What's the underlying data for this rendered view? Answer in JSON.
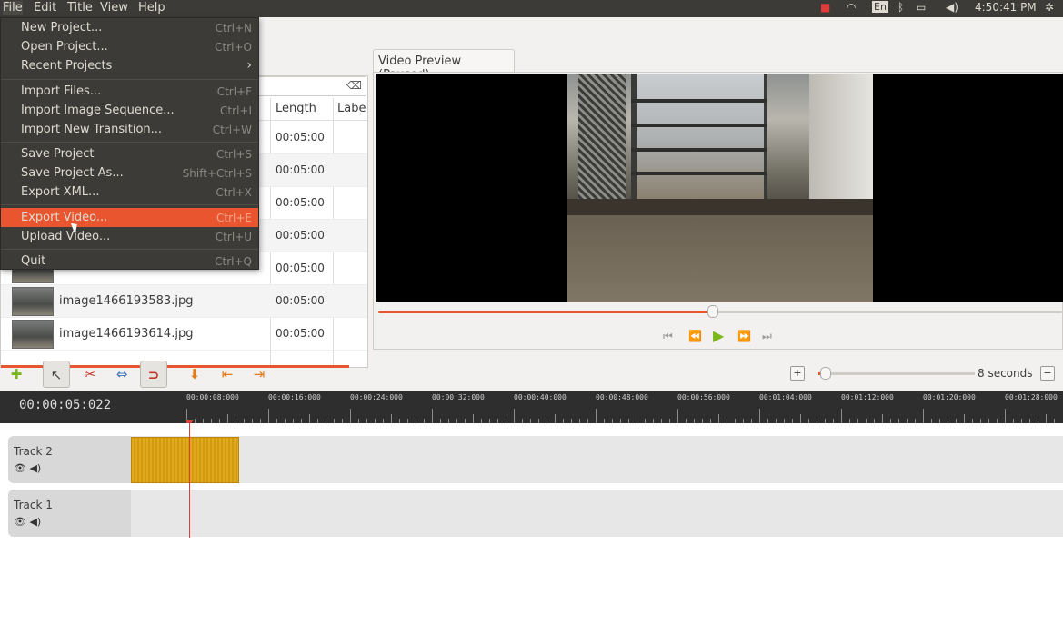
{
  "menubar": {
    "items": [
      {
        "label": "File"
      },
      {
        "label": "Edit"
      },
      {
        "label": "Title"
      },
      {
        "label": "View"
      },
      {
        "label": "Help"
      }
    ]
  },
  "tray": {
    "keyboard": "En",
    "clock": "4:50:41 PM"
  },
  "file_menu": {
    "items": [
      {
        "label": "New Project...",
        "shortcut": "Ctrl+N"
      },
      {
        "label": "Open Project...",
        "shortcut": "Ctrl+O"
      },
      {
        "label": "Recent Projects",
        "shortcut": "›"
      },
      {
        "label": "Import Files...",
        "shortcut": "Ctrl+F"
      },
      {
        "label": "Import Image Sequence...",
        "shortcut": "Ctrl+I"
      },
      {
        "label": "Import New Transition...",
        "shortcut": "Ctrl+W"
      },
      {
        "label": "Save Project",
        "shortcut": "Ctrl+S"
      },
      {
        "label": "Save Project As...",
        "shortcut": "Shift+Ctrl+S"
      },
      {
        "label": "Export XML...",
        "shortcut": "Ctrl+X"
      },
      {
        "label": "Export Video...",
        "shortcut": "Ctrl+E"
      },
      {
        "label": "Upload Video...",
        "shortcut": "Ctrl+U"
      },
      {
        "label": "Quit",
        "shortcut": "Ctrl+Q"
      }
    ]
  },
  "files": {
    "columns": {
      "length": "Length",
      "label": "Labe"
    },
    "rows": [
      {
        "name": "",
        "length": "00:05:00"
      },
      {
        "name": "",
        "length": "00:05:00"
      },
      {
        "name": "",
        "length": "00:05:00"
      },
      {
        "name": "",
        "length": "00:05:00"
      },
      {
        "name": "",
        "length": "00:05:00"
      },
      {
        "name": "image1466193583.jpg",
        "length": "00:05:00"
      },
      {
        "name": "image1466193614.jpg",
        "length": "00:05:00"
      }
    ]
  },
  "preview": {
    "tab_label": "Video Preview (Paused)",
    "progress": 0.49
  },
  "toolbar": {
    "zoom_label": "8 seconds"
  },
  "timeline": {
    "timecode": "00:00:05:022",
    "ticks": [
      "00:00:08:000",
      "00:00:16:000",
      "00:00:24:000",
      "00:00:32:000",
      "00:00:40:000",
      "00:00:48:000",
      "00:00:56:000",
      "00:01:04:000",
      "00:01:12:000",
      "00:01:20:000",
      "00:01:28:000"
    ],
    "tracks": [
      {
        "name": "Track 2"
      },
      {
        "name": "Track 1"
      }
    ]
  },
  "colors": {
    "accent": "#e8552e",
    "clip": "#e0a91c",
    "playhead": "#e23b3b"
  }
}
